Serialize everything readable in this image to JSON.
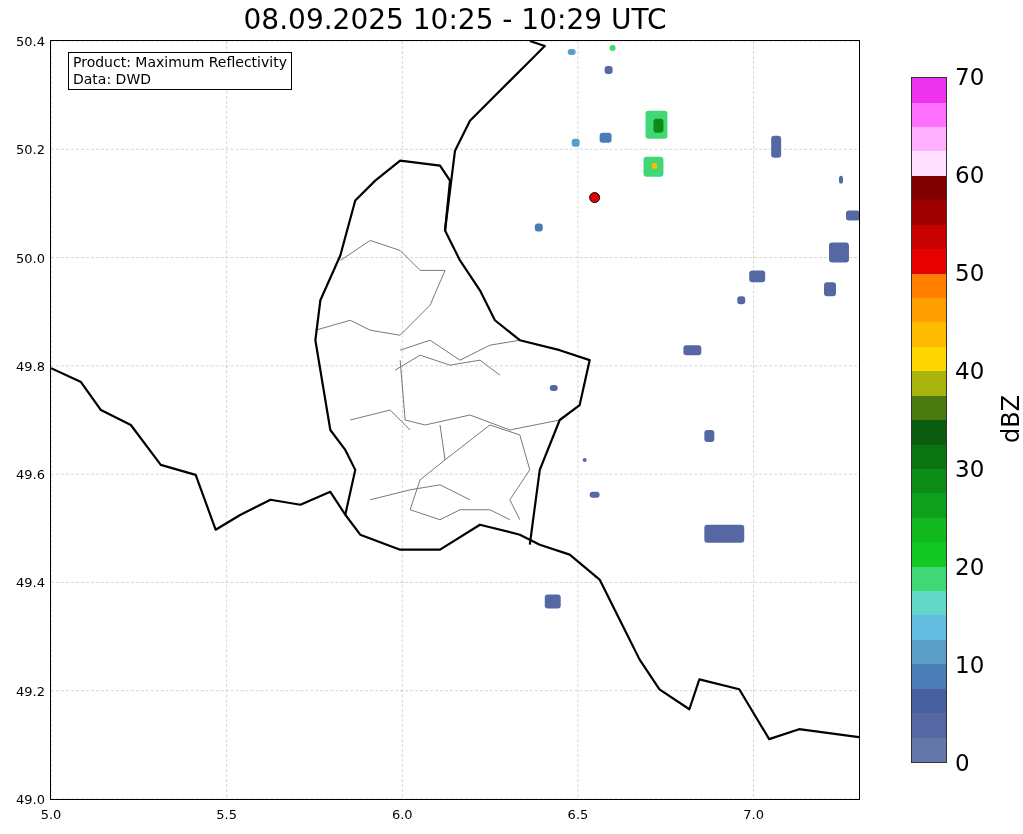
{
  "title": "08.09.2025 10:25 - 10:29 UTC",
  "legend": {
    "lines": [
      "Product: Maximum Reflectivity",
      "Data: DWD"
    ]
  },
  "axes": {
    "yticks": [
      "50.4",
      "50.2",
      "50.0",
      "49.8",
      "49.6",
      "49.4",
      "49.2",
      "49.0"
    ],
    "xticks": [
      "5.0",
      "5.5",
      "6.0",
      "6.5",
      "7.0"
    ]
  },
  "colorbar": {
    "label": "dBZ",
    "ticks": [
      "70",
      "60",
      "50",
      "40",
      "30",
      "20",
      "10",
      "0"
    ]
  }
}
